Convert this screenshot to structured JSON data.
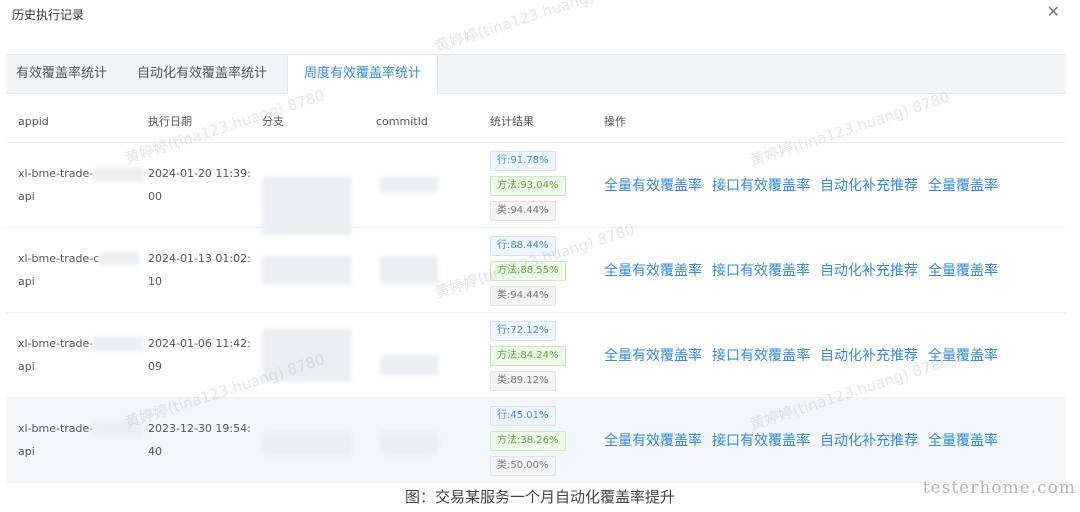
{
  "dialog": {
    "title": "历史执行记录",
    "close_icon": "close-icon"
  },
  "tabs": [
    {
      "label": "有效覆盖率统计",
      "active": false
    },
    {
      "label": "自动化有效覆盖率统计",
      "active": false
    },
    {
      "label": "周度有效覆盖率统计",
      "active": true
    }
  ],
  "table": {
    "headers": [
      "appid",
      "执行日期",
      "分支",
      "commitId",
      "统计结果",
      "操作"
    ],
    "rows": [
      {
        "appid_line1": "xl-bme-trade-",
        "appid_line2": "api",
        "date_line1": "2024-01-20 11:39:",
        "date_line2": "00",
        "line": "行:91.78%",
        "method": "方法:93.04%",
        "cls": "类:94.44%"
      },
      {
        "appid_line1": "xl-bme-trade-c",
        "appid_line2": "api",
        "date_line1": "2024-01-13 01:02:",
        "date_line2": "10",
        "line": "行:88.44%",
        "method": "方法:88.55%",
        "cls": "类:94.44%"
      },
      {
        "appid_line1": "xl-bme-trade-",
        "appid_line2": "api",
        "date_line1": "2024-01-06 11:42:",
        "date_line2": "09",
        "line": "行:72.12%",
        "method": "方法:84.24%",
        "cls": "类:89.12%"
      },
      {
        "appid_line1": "xl-bme-trade-",
        "appid_line2": "api",
        "date_line1": "2023-12-30 19:54:",
        "date_line2": "40",
        "line": "行:45.01%",
        "method": "方法:38.26%",
        "cls": "类:50.00%"
      }
    ],
    "operations": [
      "全量有效覆盖率",
      "接口有效覆盖率",
      "自动化补充推荐",
      "全量覆盖率"
    ]
  },
  "caption": "图：交易某服务一个月自动化覆盖率提升",
  "brand": "testerhome.com",
  "watermark": "黄婷婷(tina123.huang) 8780",
  "colors": {
    "accent": "#2f8cea",
    "tab_bg": "#f2f4f7",
    "line_badge": "#3b8de0",
    "method_badge": "#59a83a",
    "class_badge": "#777777"
  }
}
